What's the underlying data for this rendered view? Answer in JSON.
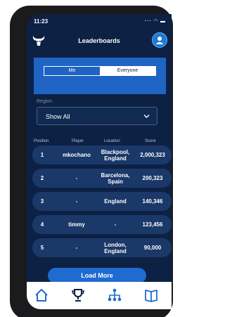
{
  "status_bar": {
    "time": "11:23",
    "icons": "··· ◠ ▬"
  },
  "header": {
    "title": "Leaderboards",
    "logo_icon": "bull-logo-icon",
    "profile_icon": "user-icon"
  },
  "toggle": {
    "me_label": "Me",
    "everyone_label": "Everyone",
    "selected": "Everyone"
  },
  "region": {
    "label": "Region",
    "value": "Show All"
  },
  "columns": {
    "position": "Position",
    "player": "Player",
    "location": "Location",
    "score": "Score"
  },
  "rows": [
    {
      "position": "1",
      "player": "mkochano",
      "location": "Blackpool, England",
      "score": "2,000,323"
    },
    {
      "position": "2",
      "player": "-",
      "location": "Barcelona, Spain",
      "score": "200,323"
    },
    {
      "position": "3",
      "player": "-",
      "location": "England",
      "score": "140,346"
    },
    {
      "position": "4",
      "player": "timmy",
      "location": "-",
      "score": "123,456"
    },
    {
      "position": "5",
      "player": "-",
      "location": "London, England",
      "score": "90,000"
    }
  ],
  "load_more_label": "Load More",
  "nav": {
    "items": [
      "home-icon",
      "trophy-icon",
      "hierarchy-icon",
      "book-icon"
    ]
  },
  "colors": {
    "background": "#0c2144",
    "panel": "#1f63c4",
    "row": "#1a3868",
    "accent": "#1f6bd0"
  }
}
